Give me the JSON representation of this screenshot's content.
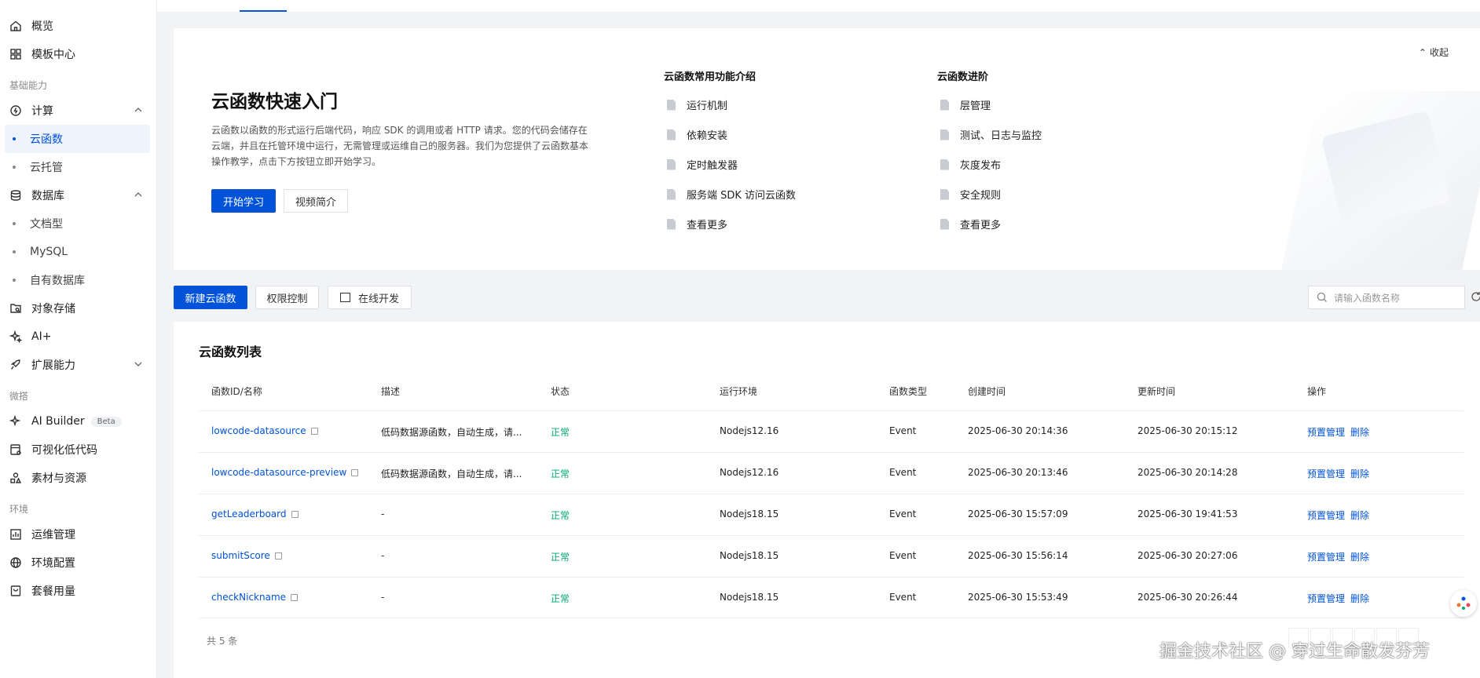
{
  "sidebar": {
    "items": [
      {
        "label": "概览"
      },
      {
        "label": "模板中心"
      },
      {
        "label": "计算"
      },
      {
        "label": "云函数"
      },
      {
        "label": "云托管"
      },
      {
        "label": "数据库"
      },
      {
        "label": "文档型"
      },
      {
        "label": "MySQL"
      },
      {
        "label": "自有数据库"
      },
      {
        "label": "对象存储"
      },
      {
        "label": "AI+"
      },
      {
        "label": "扩展能力"
      },
      {
        "label": "AI Builder"
      },
      {
        "label": "可视化低代码"
      },
      {
        "label": "素材与资源"
      },
      {
        "label": "运维管理"
      },
      {
        "label": "环境配置"
      },
      {
        "label": "套餐用量"
      }
    ],
    "groups": {
      "basic": "基础能力",
      "micro": "微搭",
      "env": "环境"
    },
    "beta": "Beta"
  },
  "intro": {
    "title": "云函数快速入门",
    "desc": "云函数以函数的形式运行后端代码，响应 SDK 的调用或者 HTTP 请求。您的代码会储存在云端，并且在托管环境中运行，无需管理或运维自己的服务器。我们为您提供了云函数基本操作教学，点击下方按钮立即开始学习。",
    "start_label": "开始学习",
    "video_label": "视频简介",
    "collapse_label": "收起",
    "col1": {
      "title": "云函数常用功能介绍",
      "links": [
        "运行机制",
        "依赖安装",
        "定时触发器",
        "服务端 SDK 访问云函数",
        "查看更多"
      ]
    },
    "col2": {
      "title": "云函数进阶",
      "links": [
        "层管理",
        "测试、日志与监控",
        "灰度发布",
        "安全规则",
        "查看更多"
      ]
    }
  },
  "toolbar": {
    "new_label": "新建云函数",
    "perm_label": "权限控制",
    "online_label": "在线开发",
    "search_placeholder": "请输入函数名称"
  },
  "table": {
    "title": "云函数列表",
    "headers": [
      "函数ID/名称",
      "描述",
      "状态",
      "运行环境",
      "函数类型",
      "创建时间",
      "更新时间",
      "操作"
    ],
    "rows": [
      {
        "name": "lowcode-datasource",
        "desc": "低码数据源函数，自动生成，请...",
        "status": "正常",
        "runtime": "Nodejs12.16",
        "type": "Event",
        "created": "2025-06-30 20:14:36",
        "updated": "2025-06-30 20:15:12"
      },
      {
        "name": "lowcode-datasource-preview",
        "desc": "低码数据源函数，自动生成，请...",
        "status": "正常",
        "runtime": "Nodejs12.16",
        "type": "Event",
        "created": "2025-06-30 20:13:46",
        "updated": "2025-06-30 20:14:28"
      },
      {
        "name": "getLeaderboard",
        "desc": "-",
        "status": "正常",
        "runtime": "Nodejs18.15",
        "type": "Event",
        "created": "2025-06-30 15:57:09",
        "updated": "2025-06-30 19:41:53"
      },
      {
        "name": "submitScore",
        "desc": "-",
        "status": "正常",
        "runtime": "Nodejs18.15",
        "type": "Event",
        "created": "2025-06-30 15:56:14",
        "updated": "2025-06-30 20:27:06"
      },
      {
        "name": "checkNickname",
        "desc": "-",
        "status": "正常",
        "runtime": "Nodejs18.15",
        "type": "Event",
        "created": "2025-06-30 15:53:49",
        "updated": "2025-06-30 20:26:44"
      }
    ],
    "action_manage": "预置管理",
    "action_delete": "删除",
    "total": "共 5 条"
  },
  "watermark": "掘金技术社区 @ 穿过生命散发芬芳"
}
